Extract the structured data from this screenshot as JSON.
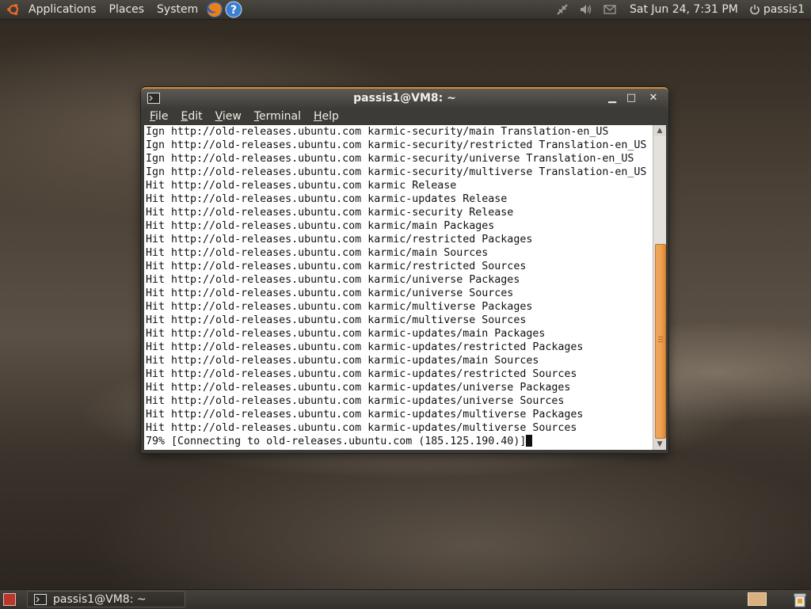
{
  "top_panel": {
    "menus": [
      "Applications",
      "Places",
      "System"
    ],
    "clock": "Sat Jun 24,  7:31 PM",
    "user": "passis1"
  },
  "terminal": {
    "title": "passis1@VM8: ~",
    "menu": [
      {
        "first": "F",
        "rest": "ile"
      },
      {
        "first": "E",
        "rest": "dit"
      },
      {
        "first": "V",
        "rest": "iew"
      },
      {
        "first": "T",
        "rest": "erminal"
      },
      {
        "first": "H",
        "rest": "elp"
      }
    ],
    "lines": [
      "Ign http://old-releases.ubuntu.com karmic-security/main Translation-en_US",
      "Ign http://old-releases.ubuntu.com karmic-security/restricted Translation-en_US",
      "Ign http://old-releases.ubuntu.com karmic-security/universe Translation-en_US",
      "Ign http://old-releases.ubuntu.com karmic-security/multiverse Translation-en_US",
      "Hit http://old-releases.ubuntu.com karmic Release",
      "Hit http://old-releases.ubuntu.com karmic-updates Release",
      "Hit http://old-releases.ubuntu.com karmic-security Release",
      "Hit http://old-releases.ubuntu.com karmic/main Packages",
      "Hit http://old-releases.ubuntu.com karmic/restricted Packages",
      "Hit http://old-releases.ubuntu.com karmic/main Sources",
      "Hit http://old-releases.ubuntu.com karmic/restricted Sources",
      "Hit http://old-releases.ubuntu.com karmic/universe Packages",
      "Hit http://old-releases.ubuntu.com karmic/universe Sources",
      "Hit http://old-releases.ubuntu.com karmic/multiverse Packages",
      "Hit http://old-releases.ubuntu.com karmic/multiverse Sources",
      "Hit http://old-releases.ubuntu.com karmic-updates/main Packages",
      "Hit http://old-releases.ubuntu.com karmic-updates/restricted Packages",
      "Hit http://old-releases.ubuntu.com karmic-updates/main Sources",
      "Hit http://old-releases.ubuntu.com karmic-updates/restricted Sources",
      "Hit http://old-releases.ubuntu.com karmic-updates/universe Packages",
      "Hit http://old-releases.ubuntu.com karmic-updates/universe Sources",
      "Hit http://old-releases.ubuntu.com karmic-updates/multiverse Packages",
      "Hit http://old-releases.ubuntu.com karmic-updates/multiverse Sources",
      "79% [Connecting to old-releases.ubuntu.com (185.125.190.40)]"
    ]
  },
  "bottom_panel": {
    "task_title": "passis1@VM8: ~"
  },
  "icons": {
    "ubuntu": "ubuntu-logo-icon",
    "firefox": "firefox-icon",
    "help": "help-icon",
    "network": "network-icon",
    "volume": "volume-icon",
    "mail": "mail-icon",
    "power": "power-icon",
    "terminal": "terminal-icon",
    "trash": "trash-icon"
  },
  "colors": {
    "accent": "#e07a2e",
    "panel": "#3c3b37"
  }
}
